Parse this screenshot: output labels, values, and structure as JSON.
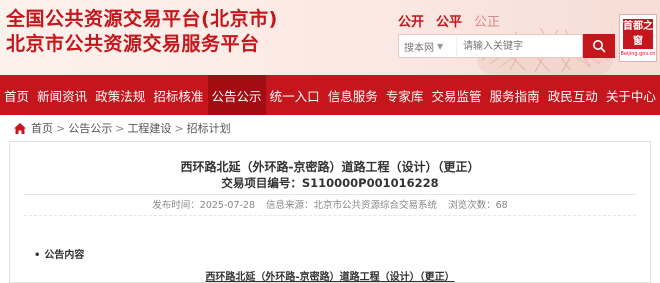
{
  "header": {
    "title_line1": "全国公共资源交易平台(北京市)",
    "title_line2": "北京市公共资源交易服务平台",
    "slogans": [
      "公开",
      "公平",
      "公正"
    ],
    "search": {
      "scope": "搜本网",
      "placeholder": "请输入关键字"
    },
    "logo": {
      "chars": [
        "首",
        "都",
        "之",
        "窗"
      ],
      "subtext": "Beijing.gov.cn"
    }
  },
  "nav": {
    "items": [
      {
        "label": "首页"
      },
      {
        "label": "新闻资讯"
      },
      {
        "label": "政策法规"
      },
      {
        "label": "招标核准"
      },
      {
        "label": "公告公示"
      },
      {
        "label": "统一入口"
      },
      {
        "label": "信息服务"
      },
      {
        "label": "专家库"
      },
      {
        "label": "交易监管"
      },
      {
        "label": "服务指南"
      },
      {
        "label": "政民互动"
      },
      {
        "label": "关于中心"
      }
    ],
    "active_index": 4
  },
  "breadcrumb": [
    "首页",
    "公告公示",
    "工程建设",
    "招标计划"
  ],
  "article": {
    "title": "西环路北延（外环路-京密路）道路工程（设计）（更正）",
    "code": "交易项目编号：S110000P001016228",
    "published": "发布时间：2025-07-28",
    "source": "信息来源：北京市公共资源综合交易系统",
    "views": "浏览次数：68",
    "section_label": "公告内容",
    "body_title": "西环路北延（外环路-京密路）道路工程（设计）（更正）"
  },
  "colors": {
    "brand_red": "#c4161c",
    "active_nav": "#a10d12",
    "header_bg": "#fbe9e3"
  }
}
